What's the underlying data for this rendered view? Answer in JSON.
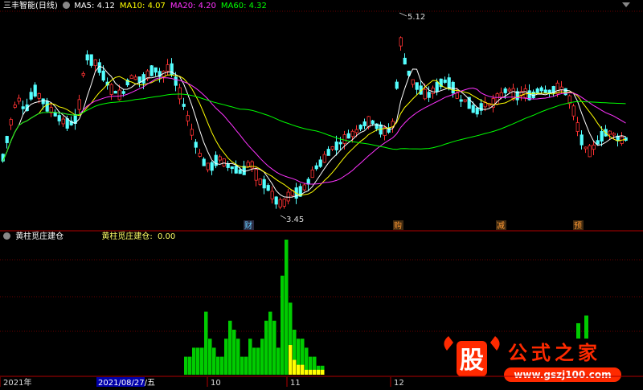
{
  "header": {
    "title": "三丰智能(日线)",
    "ma_items": [
      {
        "label": "MA5:",
        "value": "4.12",
        "color": "#ffffff"
      },
      {
        "label": "MA10:",
        "value": "4.07",
        "color": "#ffff00"
      },
      {
        "label": "MA20:",
        "value": "4.20",
        "color": "#ff33ff"
      },
      {
        "label": "MA60:",
        "value": "4.32",
        "color": "#00ff00"
      }
    ]
  },
  "sub_header": {
    "title": "黄柱觅庄建仓",
    "indicator_label": "黄柱觅庄建仓:",
    "indicator_value": "0.00"
  },
  "chart_data": [
    {
      "type": "candlestick",
      "title": "三丰智能(日线)",
      "annotations": [
        {
          "text": "5.12",
          "kind": "high"
        },
        {
          "text": "3.45",
          "kind": "low"
        }
      ],
      "markers": [
        "财",
        "购",
        "减",
        "预"
      ],
      "series": [
        {
          "name": "MA5",
          "color": "#ffffff"
        },
        {
          "name": "MA10",
          "color": "#ffff00"
        },
        {
          "name": "MA20",
          "color": "#ff33ff"
        },
        {
          "name": "MA60",
          "color": "#00ff00"
        }
      ]
    },
    {
      "type": "bar",
      "title": "黄柱觅庄建仓",
      "green_values": [
        2,
        2,
        3,
        3,
        3,
        7,
        4,
        3,
        2,
        2,
        4,
        6,
        5,
        4,
        2,
        2,
        4,
        3,
        3,
        4,
        6,
        7,
        6,
        3,
        11,
        15,
        8,
        5,
        4,
        4,
        3,
        2,
        2,
        1,
        1
      ],
      "yellow_values": [
        0,
        0,
        0,
        0,
        0,
        0,
        0,
        0,
        0,
        0,
        0,
        0,
        0,
        0,
        0,
        0,
        0,
        0,
        0,
        0,
        0,
        0,
        0,
        0,
        0,
        0,
        6,
        3,
        2,
        2,
        1,
        1,
        1,
        1,
        1
      ],
      "late_green_values": [
        2,
        3
      ],
      "colors": {
        "green": "#00cc00",
        "yellow": "#ffff00"
      }
    }
  ],
  "x_axis": {
    "labels": [
      "2021年",
      "2021/08/27/五",
      "10",
      "11",
      "12"
    ]
  },
  "watermark": {
    "logo_text": "股",
    "site_name": "公式之家",
    "url": "www.gszj100.com"
  },
  "colors": {
    "background": "#000000",
    "up": "#ff3232",
    "down": "#54ffff",
    "grid": "#7a0000"
  }
}
